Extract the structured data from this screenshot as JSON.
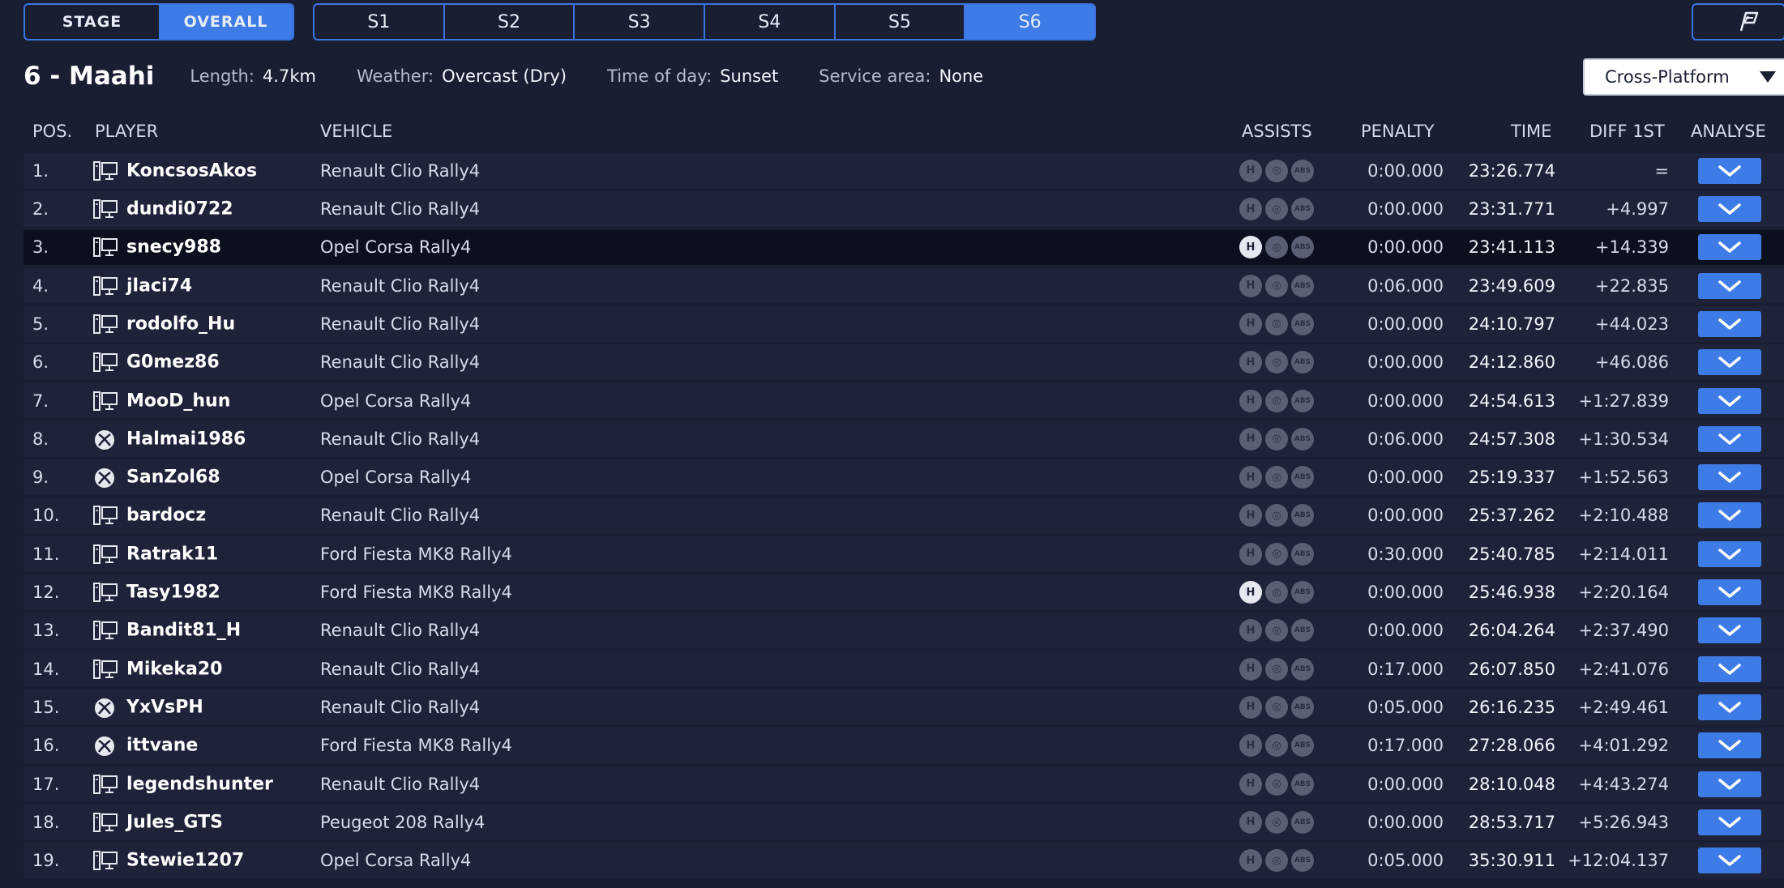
{
  "mode_toggle": {
    "stage": "STAGE",
    "overall": "OVERALL"
  },
  "stage_tabs": [
    "S1",
    "S2",
    "S3",
    "S4",
    "S5",
    "S6"
  ],
  "stage": {
    "title": "6 - Maahi",
    "length_label": "Length:",
    "length": "4.7km",
    "weather_label": "Weather:",
    "weather": "Overcast (Dry)",
    "time_label": "Time of day:",
    "time": "Sunset",
    "service_label": "Service area:",
    "service": "None"
  },
  "platform_filter": "Cross-Platform",
  "columns": {
    "pos": "POS.",
    "player": "PLAYER",
    "vehicle": "VEHICLE",
    "assists": "ASSISTS",
    "penalty": "PENALTY",
    "time": "TIME",
    "diff": "DIFF 1ST",
    "analyse": "ANALYSE"
  },
  "colors": {
    "accent": "#3d7be6",
    "background": "#1a1e33",
    "row": "#1e2339",
    "row_highlight": "#0c101e"
  },
  "rows": [
    {
      "pos": "1.",
      "platform": "pc",
      "player": "KoncsosAkos",
      "vehicle": "Renault Clio Rally4",
      "assist_on": false,
      "penalty": "0:00.000",
      "time": "23:26.774",
      "diff": "="
    },
    {
      "pos": "2.",
      "platform": "pc",
      "player": "dundi0722",
      "vehicle": "Renault Clio Rally4",
      "assist_on": false,
      "penalty": "0:00.000",
      "time": "23:31.771",
      "diff": "+4.997"
    },
    {
      "pos": "3.",
      "platform": "pc",
      "player": "snecy988",
      "vehicle": "Opel Corsa Rally4",
      "assist_on": true,
      "highlight": true,
      "penalty": "0:00.000",
      "time": "23:41.113",
      "diff": "+14.339"
    },
    {
      "pos": "4.",
      "platform": "pc",
      "player": "jlaci74",
      "vehicle": "Renault Clio Rally4",
      "assist_on": false,
      "penalty": "0:06.000",
      "time": "23:49.609",
      "diff": "+22.835"
    },
    {
      "pos": "5.",
      "platform": "pc",
      "player": "rodolfo_Hu",
      "vehicle": "Renault Clio Rally4",
      "assist_on": false,
      "penalty": "0:00.000",
      "time": "24:10.797",
      "diff": "+44.023"
    },
    {
      "pos": "6.",
      "platform": "pc",
      "player": "G0mez86",
      "vehicle": "Renault Clio Rally4",
      "assist_on": false,
      "penalty": "0:00.000",
      "time": "24:12.860",
      "diff": "+46.086"
    },
    {
      "pos": "7.",
      "platform": "pc",
      "player": "MooD_hun",
      "vehicle": "Opel Corsa Rally4",
      "assist_on": false,
      "penalty": "0:00.000",
      "time": "24:54.613",
      "diff": "+1:27.839"
    },
    {
      "pos": "8.",
      "platform": "xbox",
      "player": "Halmai1986",
      "vehicle": "Renault Clio Rally4",
      "assist_on": false,
      "penalty": "0:06.000",
      "time": "24:57.308",
      "diff": "+1:30.534"
    },
    {
      "pos": "9.",
      "platform": "xbox",
      "player": "SanZol68",
      "vehicle": "Opel Corsa Rally4",
      "assist_on": false,
      "penalty": "0:00.000",
      "time": "25:19.337",
      "diff": "+1:52.563"
    },
    {
      "pos": "10.",
      "platform": "pc",
      "player": "bardocz",
      "vehicle": "Renault Clio Rally4",
      "assist_on": false,
      "penalty": "0:00.000",
      "time": "25:37.262",
      "diff": "+2:10.488"
    },
    {
      "pos": "11.",
      "platform": "pc",
      "player": "Ratrak11",
      "vehicle": "Ford Fiesta MK8 Rally4",
      "assist_on": false,
      "penalty": "0:30.000",
      "time": "25:40.785",
      "diff": "+2:14.011"
    },
    {
      "pos": "12.",
      "platform": "pc",
      "player": "Tasy1982",
      "vehicle": "Ford Fiesta MK8 Rally4",
      "assist_on": true,
      "penalty": "0:00.000",
      "time": "25:46.938",
      "diff": "+2:20.164"
    },
    {
      "pos": "13.",
      "platform": "pc",
      "player": "Bandit81_H",
      "vehicle": "Renault Clio Rally4",
      "assist_on": false,
      "penalty": "0:00.000",
      "time": "26:04.264",
      "diff": "+2:37.490"
    },
    {
      "pos": "14.",
      "platform": "pc",
      "player": "Mikeka20",
      "vehicle": "Renault Clio Rally4",
      "assist_on": false,
      "penalty": "0:17.000",
      "time": "26:07.850",
      "diff": "+2:41.076"
    },
    {
      "pos": "15.",
      "platform": "xbox",
      "player": "YxVsPH",
      "vehicle": "Renault Clio Rally4",
      "assist_on": false,
      "penalty": "0:05.000",
      "time": "26:16.235",
      "diff": "+2:49.461"
    },
    {
      "pos": "16.",
      "platform": "xbox",
      "player": "ittvane",
      "vehicle": "Ford Fiesta MK8 Rally4",
      "assist_on": false,
      "penalty": "0:17.000",
      "time": "27:28.066",
      "diff": "+4:01.292"
    },
    {
      "pos": "17.",
      "platform": "pc",
      "player": "legendshunter",
      "vehicle": "Renault Clio Rally4",
      "assist_on": false,
      "penalty": "0:00.000",
      "time": "28:10.048",
      "diff": "+4:43.274"
    },
    {
      "pos": "18.",
      "platform": "pc",
      "player": "Jules_GTS",
      "vehicle": "Peugeot 208 Rally4",
      "assist_on": false,
      "penalty": "0:00.000",
      "time": "28:53.717",
      "diff": "+5:26.943"
    },
    {
      "pos": "19.",
      "platform": "pc",
      "player": "Stewie1207",
      "vehicle": "Opel Corsa Rally4",
      "assist_on": false,
      "penalty": "0:05.000",
      "time": "35:30.911",
      "diff": "+12:04.137"
    }
  ]
}
